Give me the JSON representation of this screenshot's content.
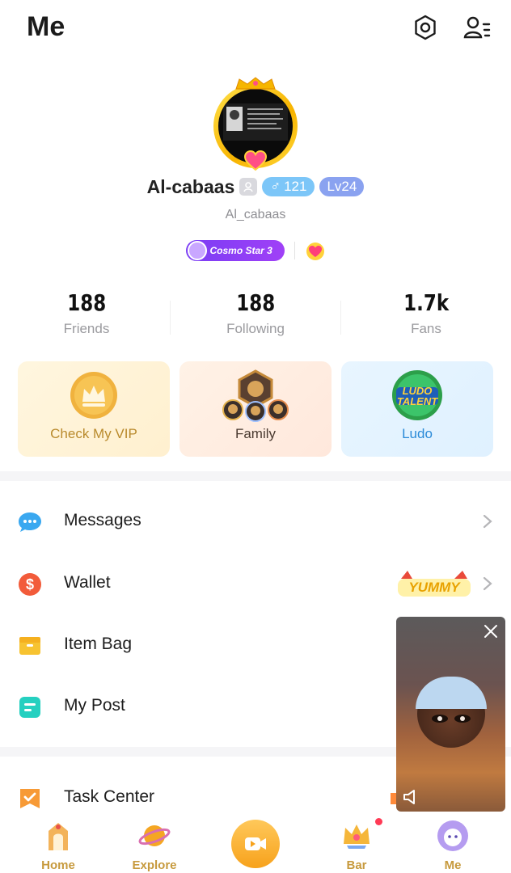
{
  "header": {
    "title": "Me",
    "settings_icon": "gear-icon",
    "contacts_icon": "user-list-icon"
  },
  "profile": {
    "username": "Al-cabaas",
    "gender_symbol": "♂",
    "gender_value": "121",
    "level": "Lv24",
    "handle": "Al_cabaas",
    "badge": "Cosmo Star 3"
  },
  "stats": [
    {
      "value": "188",
      "label": "Friends"
    },
    {
      "value": "188",
      "label": "Following"
    },
    {
      "value": "1.7k",
      "label": "Fans"
    }
  ],
  "cards": [
    {
      "label": "Check My VIP",
      "icon": "crown-icon",
      "color": "#b98a2c"
    },
    {
      "label": "Family",
      "icon": "family-lion-icon",
      "color": "#4a3a30"
    },
    {
      "label": "Ludo",
      "icon": "ludo-talent-icon",
      "color": "#2a8ad8",
      "logo_text": "LUDO TALENT"
    }
  ],
  "menu": [
    {
      "label": "Messages",
      "icon": "chat-bubble-icon",
      "color": "#3aa8f0"
    },
    {
      "label": "Wallet",
      "icon": "dollar-coin-icon",
      "color": "#f25b3a",
      "promo": "YUMMY"
    },
    {
      "label": "Item Bag",
      "icon": "bag-icon",
      "color": "#f7c331"
    },
    {
      "label": "My Post",
      "icon": "post-icon",
      "color": "#25d0c0"
    },
    {
      "label": "Task Center",
      "icon": "task-flag-icon",
      "color": "#f79a36"
    }
  ],
  "tabs": [
    {
      "label": "Home",
      "icon": "home-gate-icon"
    },
    {
      "label": "Explore",
      "icon": "planet-icon"
    },
    {
      "label": "",
      "icon": "live-camera-icon"
    },
    {
      "label": "Bar",
      "icon": "bar-crown-icon"
    },
    {
      "label": "Me",
      "icon": "me-avatar-icon"
    }
  ],
  "colors": {
    "accent": "#c79a3e",
    "gender": "#7cc6f8",
    "level": "#8aa2f0",
    "badge": "#8a3ff5"
  }
}
